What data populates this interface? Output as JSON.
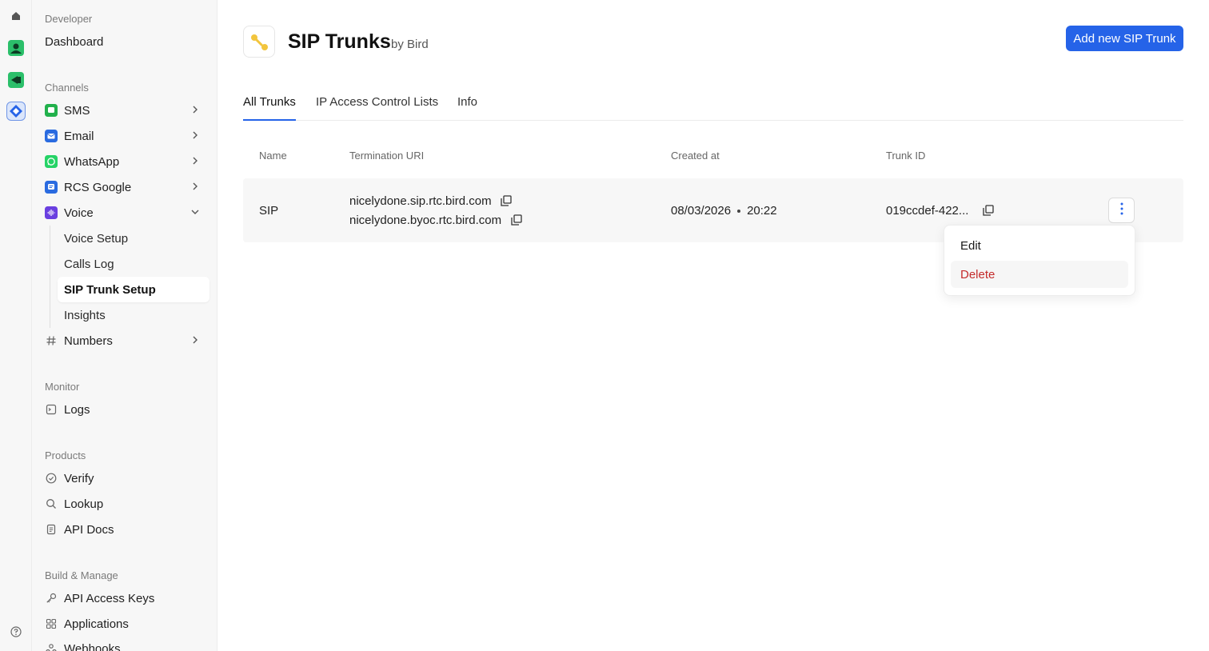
{
  "rail": {
    "items": [
      {
        "icon": "home-icon"
      },
      {
        "icon": "contacts-app-icon"
      },
      {
        "icon": "video-app-icon"
      },
      {
        "icon": "developer-app-icon"
      }
    ],
    "help_icon": "help-icon"
  },
  "sidebar": {
    "developer_section": "Developer",
    "dashboard": "Dashboard",
    "channels_section": "Channels",
    "channels": [
      {
        "label": "SMS",
        "icon": "sms-icon",
        "color": "#22b14c"
      },
      {
        "label": "Email",
        "icon": "email-icon",
        "color": "#2a6be0"
      },
      {
        "label": "WhatsApp",
        "icon": "whatsapp-icon",
        "color": "#25d366"
      },
      {
        "label": "RCS Google",
        "icon": "rcs-icon",
        "color": "#2a6be0"
      },
      {
        "label": "Voice",
        "icon": "voice-icon",
        "color": "#6a3fe0"
      }
    ],
    "voice_sub": [
      "Voice Setup",
      "Calls Log",
      "SIP Trunk Setup",
      "Insights"
    ],
    "numbers": "Numbers",
    "monitor_section": "Monitor",
    "logs": "Logs",
    "products_section": "Products",
    "products": [
      "Verify",
      "Lookup",
      "API Docs"
    ],
    "build_section": "Build & Manage",
    "build": [
      "API Access Keys",
      "Applications",
      "Webhooks"
    ]
  },
  "header": {
    "title": "SIP Trunks",
    "by": "by Bird",
    "add_button": "Add new SIP Trunk"
  },
  "tabs": [
    "All Trunks",
    "IP Access Control Lists",
    "Info"
  ],
  "table": {
    "columns": [
      "Name",
      "Termination URI",
      "Created at",
      "Trunk ID"
    ],
    "rows": [
      {
        "name": "SIP",
        "uri_1": "nicelydone.sip.rtc.bird.com",
        "uri_2": "nicelydone.byoc.rtc.bird.com",
        "created_date": "08/03/2026",
        "created_time": "20:22",
        "trunk_id": "019ccdef-422..."
      }
    ]
  },
  "row_menu": {
    "edit": "Edit",
    "delete": "Delete"
  },
  "colors": {
    "accent": "#2563e8",
    "danger": "#c42b2b"
  }
}
